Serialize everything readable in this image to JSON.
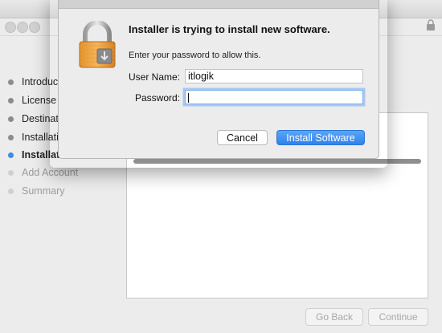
{
  "installer": {
    "steps": [
      {
        "label": "Introduction",
        "state": "done"
      },
      {
        "label": "License",
        "state": "done"
      },
      {
        "label": "Destination Select",
        "state": "done"
      },
      {
        "label": "Installation Type",
        "state": "done"
      },
      {
        "label": "Installation",
        "state": "active"
      },
      {
        "label": "Add Account",
        "state": "future"
      },
      {
        "label": "Summary",
        "state": "future"
      }
    ],
    "go_back_label": "Go Back",
    "continue_label": "Continue"
  },
  "dialog": {
    "title": "Installer is trying to install new software.",
    "message": "Enter your password to allow this.",
    "username_label": "User Name:",
    "username_value": "itlogik",
    "password_label": "Password:",
    "password_value": "",
    "cancel_label": "Cancel",
    "install_label": "Install Software",
    "accent_color": "#2e82ea",
    "icon": "padlock-icon"
  }
}
